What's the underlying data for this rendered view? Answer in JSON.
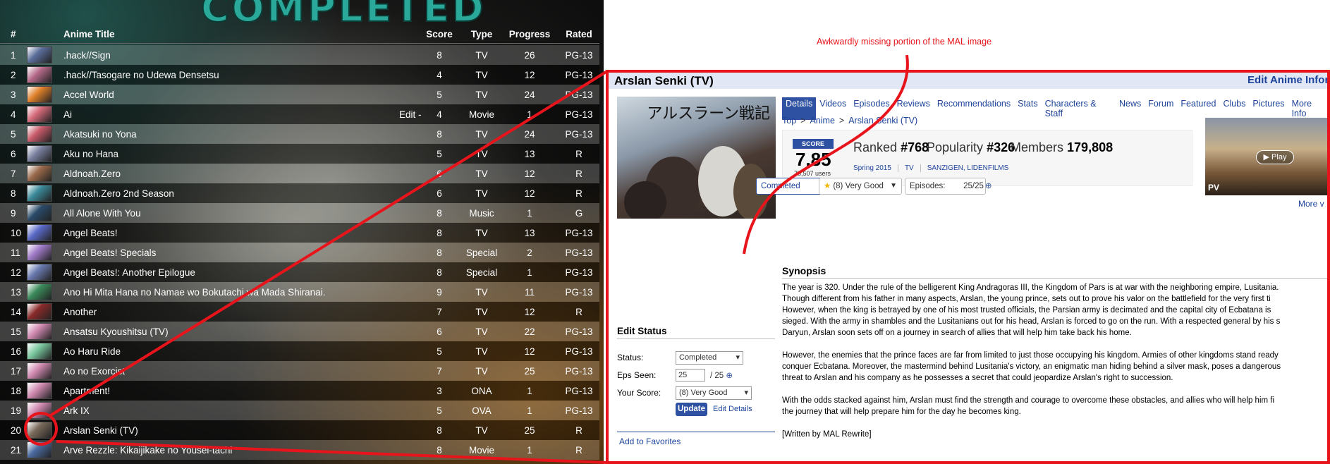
{
  "list": {
    "banner": "COMPLETED",
    "headers": {
      "num": "#",
      "title": "Anime Title",
      "score": "Score",
      "type": "Type",
      "progress": "Progress",
      "rated": "Rated"
    },
    "edit_label": "Edit -",
    "rows": [
      {
        "num": "1",
        "title": ".hack//Sign",
        "score": "8",
        "type": "TV",
        "progress": "26",
        "rated": "PG-13",
        "thumb": "#5a6e9a"
      },
      {
        "num": "2",
        "title": ".hack//Tasogare no Udewa Densetsu",
        "score": "4",
        "type": "TV",
        "progress": "12",
        "rated": "PG-13",
        "thumb": "#b66a8a"
      },
      {
        "num": "3",
        "title": "Accel World",
        "score": "5",
        "type": "TV",
        "progress": "24",
        "rated": "PG-13",
        "thumb": "#e0802a"
      },
      {
        "num": "4",
        "title": "Ai",
        "score": "4",
        "type": "Movie",
        "progress": "1",
        "rated": "PG-13",
        "thumb": "#d66a7a"
      },
      {
        "num": "5",
        "title": "Akatsuki no Yona",
        "score": "8",
        "type": "TV",
        "progress": "24",
        "rated": "PG-13",
        "thumb": "#c85a6a"
      },
      {
        "num": "6",
        "title": "Aku no Hana",
        "score": "5",
        "type": "TV",
        "progress": "13",
        "rated": "R",
        "thumb": "#7a80a0"
      },
      {
        "num": "7",
        "title": "Aldnoah.Zero",
        "score": "6",
        "type": "TV",
        "progress": "12",
        "rated": "R",
        "thumb": "#9a6a4a"
      },
      {
        "num": "8",
        "title": "Aldnoah.Zero 2nd Season",
        "score": "6",
        "type": "TV",
        "progress": "12",
        "rated": "R",
        "thumb": "#3a8a9a"
      },
      {
        "num": "9",
        "title": "All Alone With You",
        "score": "8",
        "type": "Music",
        "progress": "1",
        "rated": "G",
        "thumb": "#2a4a6a"
      },
      {
        "num": "10",
        "title": "Angel Beats!",
        "score": "8",
        "type": "TV",
        "progress": "13",
        "rated": "PG-13",
        "thumb": "#5a6ac8"
      },
      {
        "num": "11",
        "title": "Angel Beats! Specials",
        "score": "8",
        "type": "Special",
        "progress": "2",
        "rated": "PG-13",
        "thumb": "#a07ac8"
      },
      {
        "num": "12",
        "title": "Angel Beats!: Another Epilogue",
        "score": "8",
        "type": "Special",
        "progress": "1",
        "rated": "PG-13",
        "thumb": "#6a7ab0"
      },
      {
        "num": "13",
        "title": "Ano Hi Mita Hana no Namae wo Bokutachi wa Mada Shiranai.",
        "score": "9",
        "type": "TV",
        "progress": "11",
        "rated": "PG-13",
        "thumb": "#3a8a5a"
      },
      {
        "num": "14",
        "title": "Another",
        "score": "7",
        "type": "TV",
        "progress": "12",
        "rated": "R",
        "thumb": "#8a2a2a"
      },
      {
        "num": "15",
        "title": "Ansatsu Kyoushitsu (TV)",
        "score": "6",
        "type": "TV",
        "progress": "22",
        "rated": "PG-13",
        "thumb": "#d08ab0"
      },
      {
        "num": "16",
        "title": "Ao Haru Ride",
        "score": "5",
        "type": "TV",
        "progress": "12",
        "rated": "PG-13",
        "thumb": "#7ac8a0"
      },
      {
        "num": "17",
        "title": "Ao no Exorcist",
        "score": "7",
        "type": "TV",
        "progress": "25",
        "rated": "PG-13",
        "thumb": "#d08ab0"
      },
      {
        "num": "18",
        "title": "Apartment!",
        "score": "3",
        "type": "ONA",
        "progress": "1",
        "rated": "PG-13",
        "thumb": "#d08ab0"
      },
      {
        "num": "19",
        "title": "Ark IX",
        "score": "5",
        "type": "OVA",
        "progress": "1",
        "rated": "PG-13",
        "thumb": "#d08ab0"
      },
      {
        "num": "20",
        "title": "Arslan Senki (TV)",
        "score": "8",
        "type": "TV",
        "progress": "25",
        "rated": "R",
        "thumb": "#7a6a5a"
      },
      {
        "num": "21",
        "title": "Arve Rezzle: Kikaijikake no Yousei-tachi",
        "score": "8",
        "type": "Movie",
        "progress": "1",
        "rated": "R",
        "thumb": "#4a6aa0"
      }
    ]
  },
  "annotation": "Awkwardly missing portion of the MAL image",
  "mal": {
    "title": "Arslan Senki (TV)",
    "edit_link": "Edit Anime Informa",
    "poster_text": "アルスラーン戦記",
    "tabs": [
      "Details",
      "Videos",
      "Episodes",
      "Reviews",
      "Recommendations",
      "Stats",
      "Characters & Staff",
      "News",
      "Forum",
      "Featured",
      "Clubs",
      "Pictures",
      "More Info"
    ],
    "breadcrumb": [
      "Top",
      "Anime",
      "Arslan Senki (TV)"
    ],
    "score_label": "SCORE",
    "score_value": "7.85",
    "score_users": "78,507 users",
    "ranked_label": "Ranked",
    "ranked_value": "#768",
    "popularity_label": "Popularity",
    "popularity_value": "#326",
    "members_label": "Members",
    "members_value": "179,808",
    "meta": [
      "Spring 2015",
      "TV",
      "SANZIGEN, LIDENFILMS"
    ],
    "status_select": "Completed",
    "score_select": "(8) Very Good",
    "episodes_label": "Episodes:",
    "episodes_value": "25/25",
    "pv_label": "PV",
    "play_label": "Play",
    "more_videos": "More v",
    "synopsis_heading": "Synopsis",
    "synopsis": [
      "The year is 320. Under the rule of the belligerent King Andragoras III, the Kingdom of Pars is at war with the neighboring empire, Lusitania.",
      "Though different from his father in many aspects, Arslan, the young prince, sets out to prove his valor on the battlefield for the very first ti",
      "However, when the king is betrayed by one of his most trusted officials, the Parsian army is decimated and the capital city of Ecbatana is",
      "sieged. With the army in shambles and the Lusitanians out for his head, Arslan is forced to go on the run. With a respected general by his s",
      "Daryun, Arslan soon sets off on a journey in search of allies that will help him take back his home.",
      "However, the enemies that the prince faces are far from limited to just those occupying his kingdom. Armies of other kingdoms stand ready",
      "conquer Ecbatana. Moreover, the mastermind behind Lusitania's victory, an enigmatic man hiding behind a silver mask, poses a dangerous",
      "threat to Arslan and his company as he possesses a secret that could jeopardize Arslan's right to succession.",
      "With the odds stacked against him, Arslan must find the strength and courage to overcome these obstacles, and allies who will help him fi",
      "the journey that will help prepare him for the day he becomes king.",
      "[Written by MAL Rewrite]"
    ],
    "edit_status_heading": "Edit Status",
    "es_status_label": "Status:",
    "es_status_value": "Completed",
    "es_eps_label": "Eps Seen:",
    "es_eps_value": "25",
    "es_eps_total": "/ 25",
    "es_score_label": "Your Score:",
    "es_score_value": "(8) Very Good",
    "update_button": "Update",
    "edit_details": "Edit Details",
    "add_favorites": "Add to Favorites"
  },
  "colors": {
    "annotation": "#e8141c",
    "mal_blue": "#2e51a2",
    "mal_link": "#1d439b",
    "header_bg": "#e1e7f5"
  }
}
